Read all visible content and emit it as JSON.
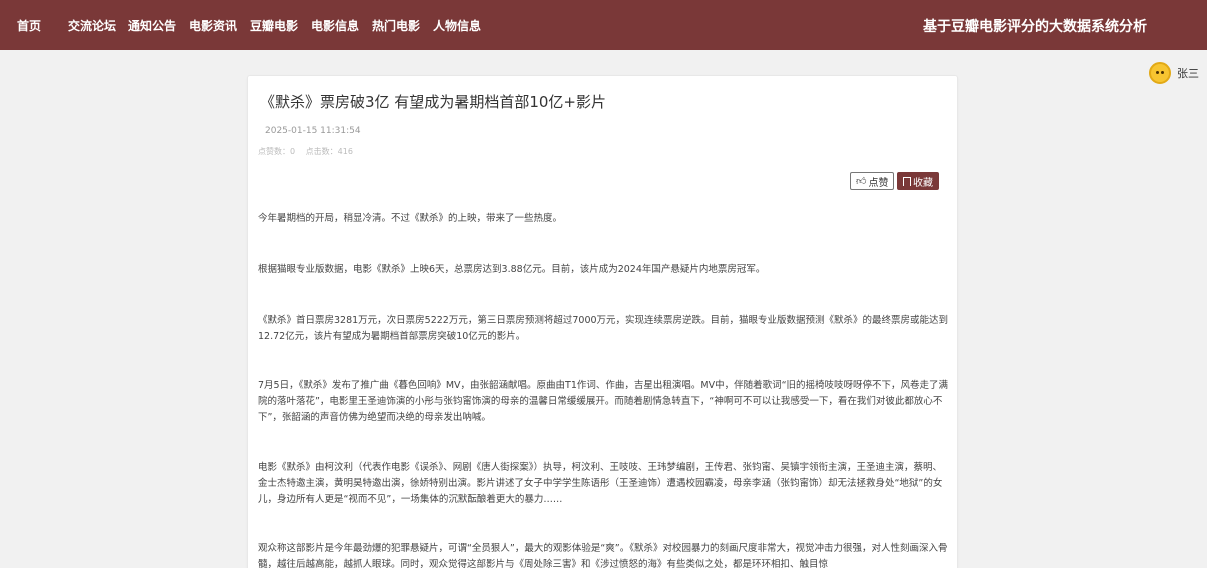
{
  "nav": {
    "items": [
      "首页",
      "交流论坛",
      "通知公告",
      "电影资讯",
      "豆瓣电影",
      "电影信息",
      "热门电影",
      "人物信息"
    ],
    "site_title": "基于豆瓣电影评分的大数据系统分析"
  },
  "user": {
    "name": "张三"
  },
  "article": {
    "title": "《默杀》票房破3亿 有望成为暑期档首部10亿+影片",
    "date": "2025-01-15 11:31:54",
    "likes_label": "点赞数：0",
    "views_label": "点击数：416",
    "like_button": "点赞",
    "favorite_button": "收藏",
    "paragraphs": [
      "今年暑期档的开局，稍显冷清。不过《默杀》的上映，带来了一些热度。",
      "根据猫眼专业版数据，电影《默杀》上映6天，总票房达到3.88亿元。目前，该片成为2024年国产悬疑片内地票房冠军。",
      "《默杀》首日票房3281万元，次日票房5222万元，第三日票房预测将超过7000万元，实现连续票房逆跌。目前，猫眼专业版数据预测《默杀》的最终票房或能达到12.72亿元，该片有望成为暑期档首部票房突破10亿元的影片。",
      "7月5日，《默杀》发布了推广曲《暮色回响》MV，由张韶涵献唱。原曲由T1作词、作曲，吉星出租演唱。MV中，伴随着歌词“旧的摇椅吱吱呀呀停不下，风卷走了满院的落叶落花”，电影里王圣迪饰演的小彤与张钧甯饰演的母亲的温馨日常缓缓展开。而随着剧情急转直下，“神啊可不可以让我感受一下，看在我们对彼此都放心不下”，张韶涵的声音仿佛为绝望而决绝的母亲发出呐喊。",
      "电影《默杀》由柯汶利（代表作电影《误杀》、网剧《唐人街探案》）执导，柯汶利、王吱吱、王玮梦编剧，王传君、张钧甯、吴镇宇领衔主演，王圣迪主演，蔡明、金士杰特邀主演，黄明昊特邀出演，徐娇特别出演。影片讲述了女子中学学生陈语彤（王圣迪饰）遭遇校园霸凌，母亲李涵（张钧甯饰）却无法拯救身处“地狱”的女儿，身边所有人更是“视而不见”，一场集体的沉默酝酿着更大的暴力……",
      "观众称这部影片是今年最劲爆的犯罪悬疑片，可谓“全员狠人”，最大的观影体验是“爽”。《默杀》对校园暴力的刻画尺度非常大，视觉冲击力很强，对人性刻画深入骨髓，越往后越高能，越抓人眼球。同时，观众觉得这部影片与《周处除三害》和《涉过愤怒的海》有些类似之处，都是环环相扣、触目惊"
    ]
  }
}
